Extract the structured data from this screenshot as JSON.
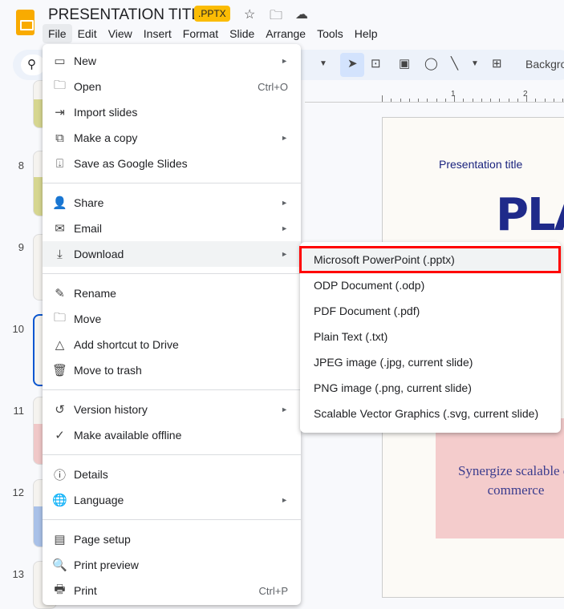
{
  "app": {
    "title": "PRESENTATION TITLE",
    "badge": ".PPTX"
  },
  "menubar": [
    "File",
    "Edit",
    "View",
    "Insert",
    "Format",
    "Slide",
    "Arrange",
    "Tools",
    "Help"
  ],
  "toolbar": {
    "background_label": "Backgro"
  },
  "ruler": [
    "1",
    "2"
  ],
  "slide_numbers": [
    "8",
    "9",
    "10",
    "11",
    "12",
    "13"
  ],
  "slide": {
    "subtitle": "Presentation title",
    "heading": "PLA",
    "pink_text": "Synergize scalable e-commerce"
  },
  "file_menu": [
    {
      "icon": "new-slides-icon",
      "glyph": "▭",
      "label": "New",
      "arrow": "►"
    },
    {
      "icon": "folder-icon",
      "glyph": "🗀",
      "label": "Open",
      "shortcut": "Ctrl+O"
    },
    {
      "icon": "import-icon",
      "glyph": "⇥",
      "label": "Import slides"
    },
    {
      "icon": "copy-icon",
      "glyph": "⧉",
      "label": "Make a copy",
      "arrow": "►"
    },
    {
      "icon": "save-icon",
      "glyph": "⍗",
      "label": "Save as Google Slides",
      "divider_after": true
    },
    {
      "icon": "share-icon",
      "glyph": "👤",
      "label": "Share",
      "arrow": "►"
    },
    {
      "icon": "email-icon",
      "glyph": "✉",
      "label": "Email",
      "arrow": "►"
    },
    {
      "icon": "download-icon",
      "glyph": "⤓",
      "label": "Download",
      "arrow": "►",
      "highlighted": true,
      "divider_after": true
    },
    {
      "icon": "rename-icon",
      "glyph": "✎",
      "label": "Rename"
    },
    {
      "icon": "move-icon",
      "glyph": "🗀",
      "label": "Move"
    },
    {
      "icon": "drive-shortcut-icon",
      "glyph": "△",
      "label": "Add shortcut to Drive"
    },
    {
      "icon": "trash-icon",
      "glyph": "🗑",
      "label": "Move to trash",
      "divider_after": true
    },
    {
      "icon": "history-icon",
      "glyph": "↺",
      "label": "Version history",
      "arrow": "►"
    },
    {
      "icon": "offline-icon",
      "glyph": "✓",
      "label": "Make available offline",
      "divider_after": true
    },
    {
      "icon": "info-icon",
      "glyph": "ⓘ",
      "label": "Details"
    },
    {
      "icon": "globe-icon",
      "glyph": "🌐",
      "label": "Language",
      "arrow": "►",
      "divider_after": true
    },
    {
      "icon": "page-setup-icon",
      "glyph": "▤",
      "label": "Page setup"
    },
    {
      "icon": "print-preview-icon",
      "glyph": "🔍",
      "label": "Print preview"
    },
    {
      "icon": "print-icon",
      "glyph": "🖶",
      "label": "Print",
      "shortcut": "Ctrl+P"
    }
  ],
  "download_submenu": [
    {
      "label": "Microsoft PowerPoint (.pptx)",
      "highlighted": true
    },
    {
      "label": "ODP Document (.odp)"
    },
    {
      "label": "PDF Document (.pdf)"
    },
    {
      "label": "Plain Text (.txt)"
    },
    {
      "label": "JPEG image (.jpg, current slide)"
    },
    {
      "label": "PNG image (.png, current slide)"
    },
    {
      "label": "Scalable Vector Graphics (.svg, current slide)"
    }
  ],
  "colors": {
    "accent": "#0b57d0",
    "badge": "#fbbc04",
    "highlight_outline": "#ff0000",
    "logo": "#f9ab00"
  }
}
